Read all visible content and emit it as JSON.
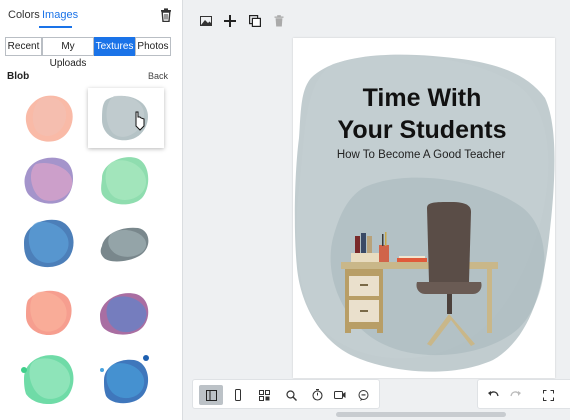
{
  "left_panel": {
    "tabs": [
      {
        "label": "Colors",
        "active": false
      },
      {
        "label": "Images",
        "active": true
      }
    ],
    "trash_icon": "trash-icon",
    "segments": [
      {
        "label": "Recent",
        "active": false
      },
      {
        "label": "My Uploads",
        "active": false
      },
      {
        "label": "Textures",
        "active": true
      },
      {
        "label": "Photos",
        "active": false
      }
    ],
    "section_title": "Blob",
    "back_label": "Back",
    "textures": [
      {
        "name": "peach-blob",
        "colors": [
          "#f7a38a",
          "#f4c0b2"
        ],
        "selected": false
      },
      {
        "name": "grey-blob",
        "colors": [
          "#8ea3a8",
          "#c4cfd2"
        ],
        "selected": true
      },
      {
        "name": "purple-blue-blob",
        "colors": [
          "#7e66b5",
          "#e8a6c9"
        ],
        "selected": false
      },
      {
        "name": "green-blob",
        "colors": [
          "#5fcf8d",
          "#a9e8c0"
        ],
        "selected": false
      },
      {
        "name": "blue-blob",
        "colors": [
          "#1f5fa8",
          "#5c9fd9"
        ],
        "selected": false
      },
      {
        "name": "slate-blob",
        "colors": [
          "#4c5f66",
          "#9fb0b4"
        ],
        "selected": false
      },
      {
        "name": "coral-blob",
        "colors": [
          "#f37e6a",
          "#fbb59f"
        ],
        "selected": false
      },
      {
        "name": "magenta-blob",
        "colors": [
          "#8c3d83",
          "#4a8bd6"
        ],
        "selected": false
      },
      {
        "name": "mint-blob",
        "colors": [
          "#3fcf8a",
          "#9be8c1"
        ],
        "selected": false
      },
      {
        "name": "navy-blob",
        "colors": [
          "#1d5fb0",
          "#4aa3dd"
        ],
        "selected": false
      }
    ]
  },
  "top_toolbar": {
    "icons": [
      "image-icon",
      "add-icon",
      "duplicate-icon",
      "delete-icon"
    ]
  },
  "canvas": {
    "title_line1": "Time With",
    "title_line2": "Your Students",
    "subtitle": "How To Become A Good Teacher",
    "blob_color": "#8ea3a8"
  },
  "bottom_toolbar": {
    "icons": [
      "layout-icon",
      "page-icon",
      "grid-icon",
      "zoom-icon",
      "timer-icon",
      "video-icon",
      "comment-icon"
    ],
    "active": "layout-icon"
  },
  "bottom_right_toolbar": {
    "icons": [
      "undo-icon",
      "redo-icon",
      "fullscreen-icon"
    ]
  },
  "colors": {
    "accent": "#1a73e8",
    "panel_bg": "#ffffff",
    "workspace_bg": "#eef0f2"
  }
}
